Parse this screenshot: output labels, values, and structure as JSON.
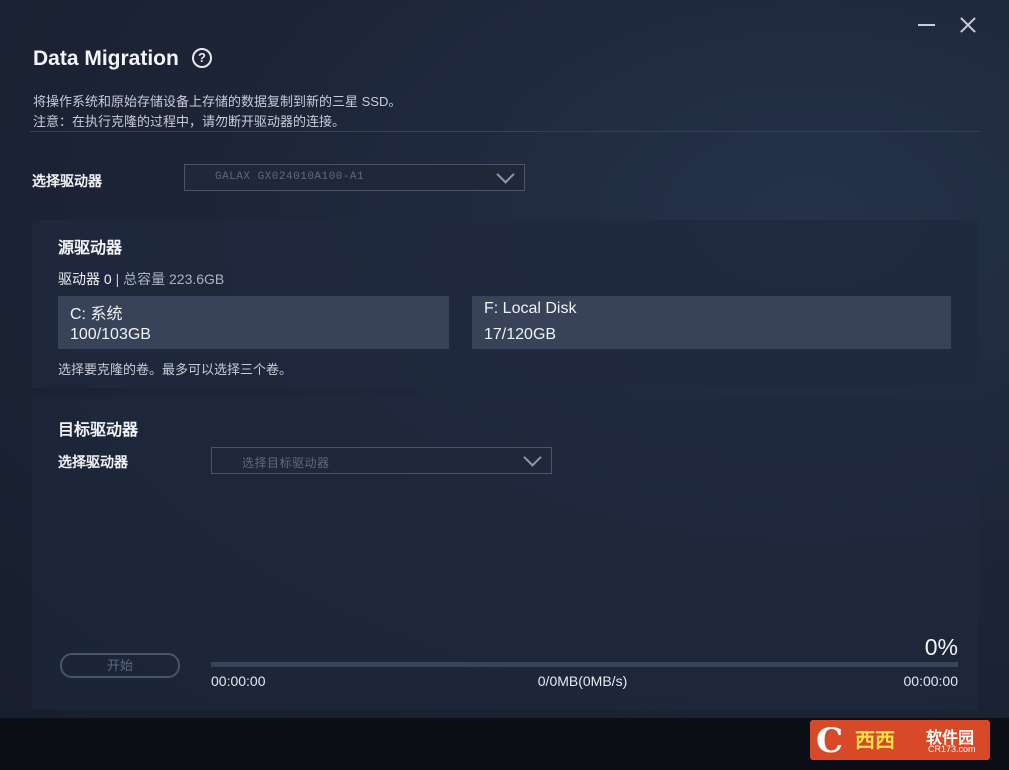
{
  "window": {
    "title": "Data Migration",
    "help_icon": "?",
    "description_line1": "将操作系统和原始存储设备上存储的数据复制到新的三星 SSD。",
    "description_line2": "注意：在执行克隆的过程中，请勿断开驱动器的连接。"
  },
  "drive_select": {
    "label": "选择驱动器",
    "selected": "GALAX GX024010A100-A1"
  },
  "source": {
    "heading": "源驱动器",
    "drive_name": "驱动器 0",
    "separator": "|",
    "capacity": "总容量 223.6GB",
    "volumes": [
      {
        "name": "C: 系统",
        "size": "100/103GB"
      },
      {
        "name": "F: Local Disk",
        "size": "17/120GB"
      }
    ],
    "hint": "选择要克隆的卷。最多可以选择三个卷。"
  },
  "target": {
    "heading": "目标驱动器",
    "select_label": "选择驱动器",
    "placeholder": "选择目标驱动器"
  },
  "progress": {
    "start_label": "开始",
    "percent_text": "0%",
    "percent_value": 0,
    "elapsed": "00:00:00",
    "transfer": "0/0MB(0MB/s)",
    "remaining": "00:00:00"
  },
  "watermark": {
    "glyph": "C",
    "main": "西西",
    "sub": "软件园",
    "url": "CR173.com"
  },
  "colors": {
    "background": "#1c2436",
    "panel": "#202a3e",
    "volume": "#38435a",
    "accent": "#5b8ee6"
  }
}
